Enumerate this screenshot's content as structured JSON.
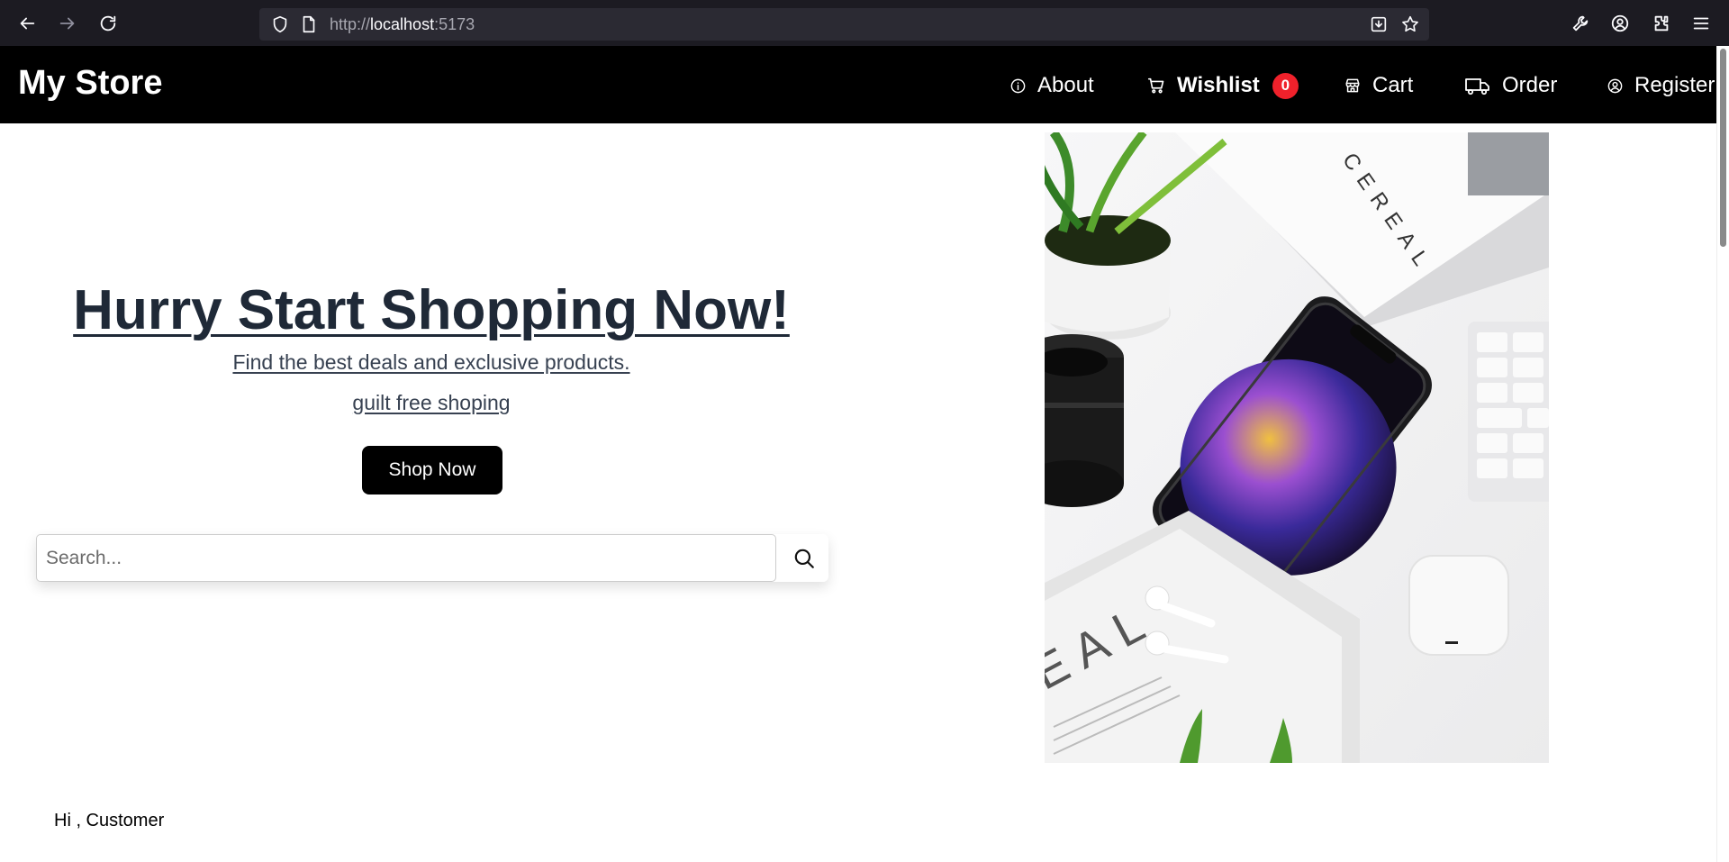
{
  "browser": {
    "url_prefix": "http://",
    "url_host": "localhost",
    "url_port": ":5173"
  },
  "navbar": {
    "brand": "My Store",
    "links": {
      "about": "About",
      "wishlist": "Wishlist",
      "wishlist_count": "0",
      "cart": "Cart",
      "order": "Order",
      "register": "Register"
    },
    "icons": [
      "info-icon",
      "cart-icon",
      "store-icon",
      "truck-icon",
      "user-circle-icon"
    ]
  },
  "hero": {
    "title": "Hurry Start Shopping Now!",
    "subtitle": "Find the best deals and exclusive products.",
    "tagline": "guilt free shoping",
    "cta": "Shop Now"
  },
  "search": {
    "placeholder": "Search...",
    "value": ""
  },
  "greeting": "Hi , Customer",
  "colors": {
    "navbar_bg": "#000000",
    "badge": "#f0212b",
    "title": "#1f2937",
    "subtitle": "#374151",
    "button_bg": "#000000"
  }
}
